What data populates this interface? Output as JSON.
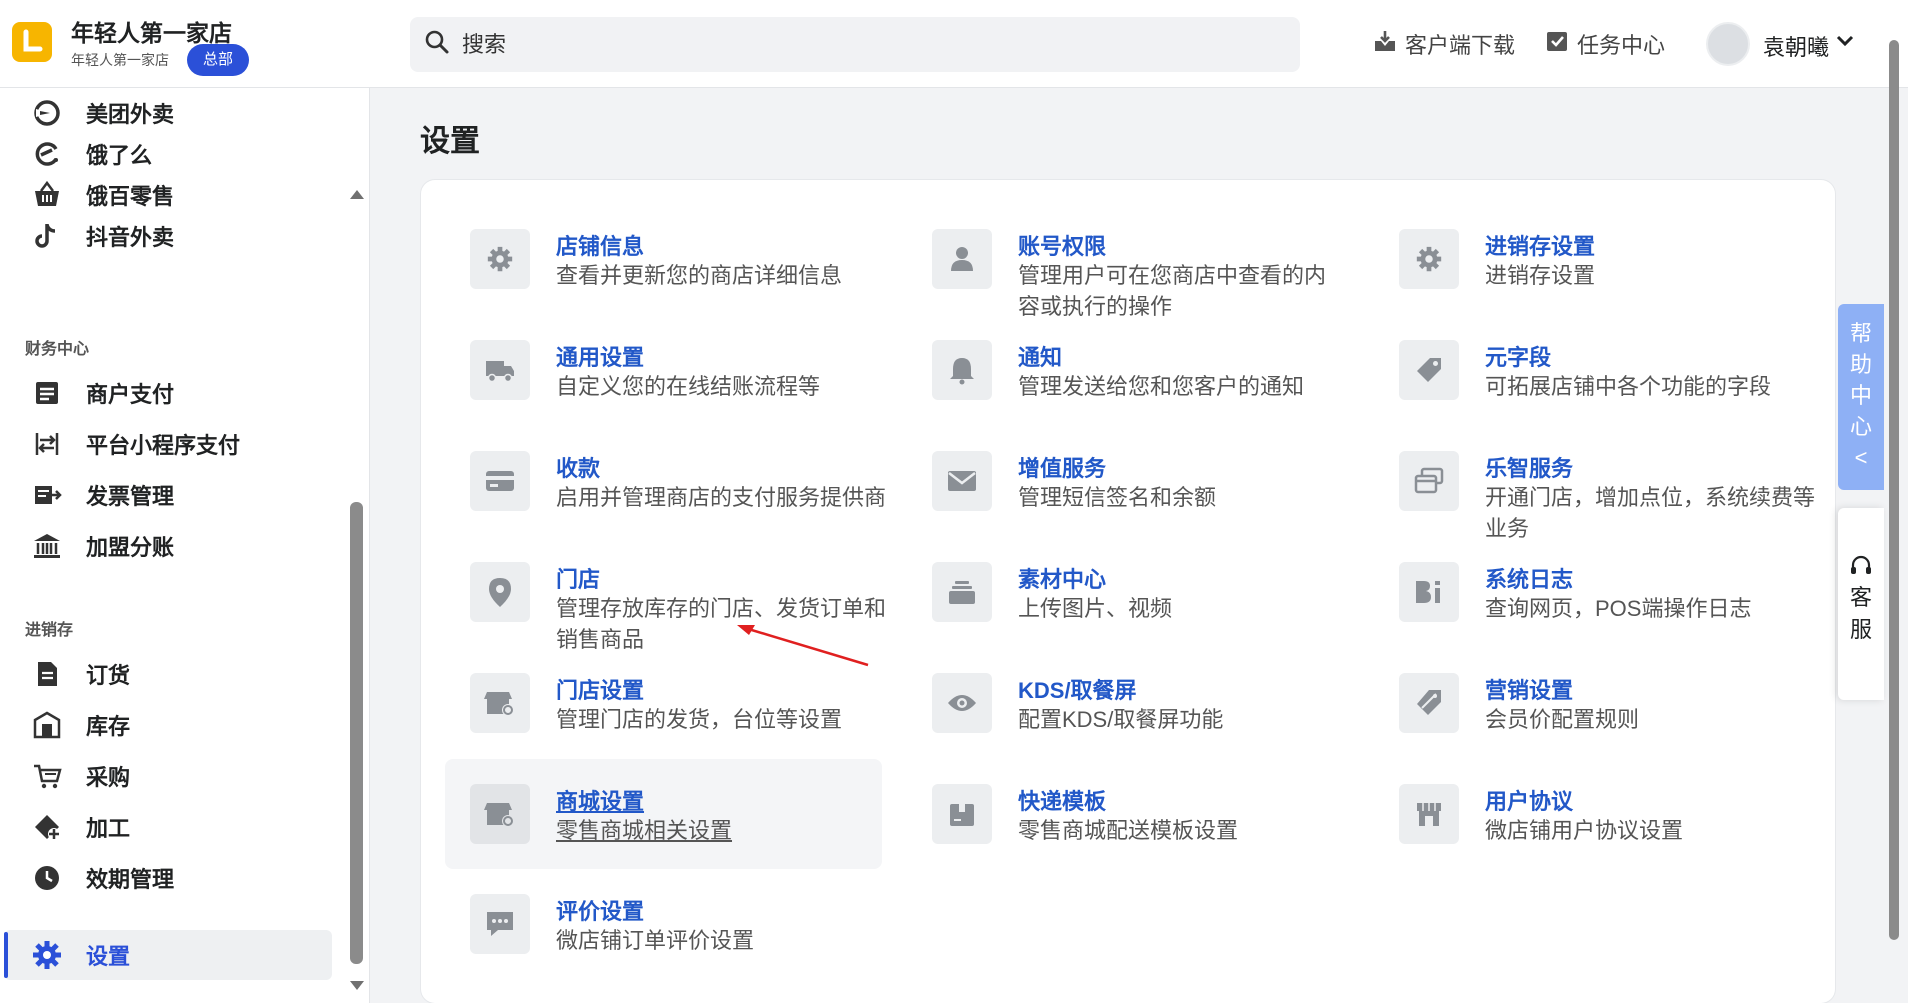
{
  "header": {
    "store_name": "年轻人第一家店",
    "store_subtitle": "年轻人第一家店",
    "hq_badge": "总部",
    "search_placeholder": "搜索",
    "download_label": "客户端下载",
    "task_center_label": "任务中心",
    "user_name": "袁朝曦"
  },
  "sidebar": {
    "top_items": [
      {
        "label": "美团外卖",
        "icon": "meituan-icon"
      },
      {
        "label": "饿了么",
        "icon": "eleme-icon"
      },
      {
        "label": "饿百零售",
        "icon": "basket-icon"
      },
      {
        "label": "抖音外卖",
        "icon": "tiktok-icon"
      }
    ],
    "finance_section": "财务中心",
    "finance_items": [
      {
        "label": "商户支付",
        "icon": "document-list-icon"
      },
      {
        "label": "平台小程序支付",
        "icon": "transfer-icon"
      },
      {
        "label": "发票管理",
        "icon": "invoice-icon"
      },
      {
        "label": "加盟分账",
        "icon": "bank-icon"
      }
    ],
    "inventory_section": "进销存",
    "inventory_items": [
      {
        "label": "订货",
        "icon": "order-doc-icon"
      },
      {
        "label": "库存",
        "icon": "warehouse-icon"
      },
      {
        "label": "采购",
        "icon": "purchase-cart-icon"
      },
      {
        "label": "加工",
        "icon": "processing-icon"
      },
      {
        "label": "效期管理",
        "icon": "clock-icon"
      }
    ],
    "active_item": {
      "label": "设置",
      "icon": "gear-icon"
    }
  },
  "main": {
    "title": "设置",
    "settings": [
      {
        "title": "店铺信息",
        "desc": "查看并更新您的商店详细信息",
        "icon": "gear-icon"
      },
      {
        "title": "账号权限",
        "desc": "管理用户可在您商店中查看的内容或执行的操作",
        "icon": "user-icon"
      },
      {
        "title": "进销存设置",
        "desc": "进销存设置",
        "icon": "gear-icon"
      },
      {
        "title": "通用设置",
        "desc": "自定义您的在线结账流程等",
        "icon": "truck-icon"
      },
      {
        "title": "通知",
        "desc": "管理发送给您和您客户的通知",
        "icon": "bell-icon"
      },
      {
        "title": "元字段",
        "desc": "可拓展店铺中各个功能的字段",
        "icon": "tag-icon"
      },
      {
        "title": "收款",
        "desc": "启用并管理商店的支付服务提供商",
        "icon": "credit-card-icon"
      },
      {
        "title": "增值服务",
        "desc": "管理短信签名和余额",
        "icon": "envelope-icon"
      },
      {
        "title": "乐智服务",
        "desc": "开通门店，增加点位，系统续费等业务",
        "icon": "cards-icon"
      },
      {
        "title": "门店",
        "desc": "管理存放库存的门店、发货订单和销售商品",
        "icon": "location-pin-icon"
      },
      {
        "title": "素材中心",
        "desc": "上传图片、视频",
        "icon": "stack-icon"
      },
      {
        "title": "系统日志",
        "desc": "查询网页，POS端操作日志",
        "icon": "log-icon"
      },
      {
        "title": "门店设置",
        "desc": "管理门店的发货，台位等设置",
        "icon": "store-gear-icon"
      },
      {
        "title": "KDS/取餐屏",
        "desc": "配置KDS/取餐屏功能",
        "icon": "eye-icon"
      },
      {
        "title": "营销设置",
        "desc": "会员价配置规则",
        "icon": "price-tag-icon"
      },
      {
        "title": "商城设置",
        "desc": "零售商城相关设置",
        "icon": "shop-gear-icon"
      },
      {
        "title": "快递模板",
        "desc": "零售商城配送模板设置",
        "icon": "package-icon"
      },
      {
        "title": "用户协议",
        "desc": "微店铺用户协议设置",
        "icon": "storefront-icon"
      },
      {
        "title": "评价设置",
        "desc": "微店铺订单评价设置",
        "icon": "chat-bubble-icon"
      }
    ]
  },
  "floating": {
    "help_center": "帮助中心",
    "help_chevron": "<",
    "customer_service": "客服"
  },
  "colors": {
    "accent": "#2b50d8",
    "link": "#2258c8",
    "logo": "#f7b500",
    "help_tab": "#8eb0f5",
    "annotation_arrow": "#e02020"
  }
}
